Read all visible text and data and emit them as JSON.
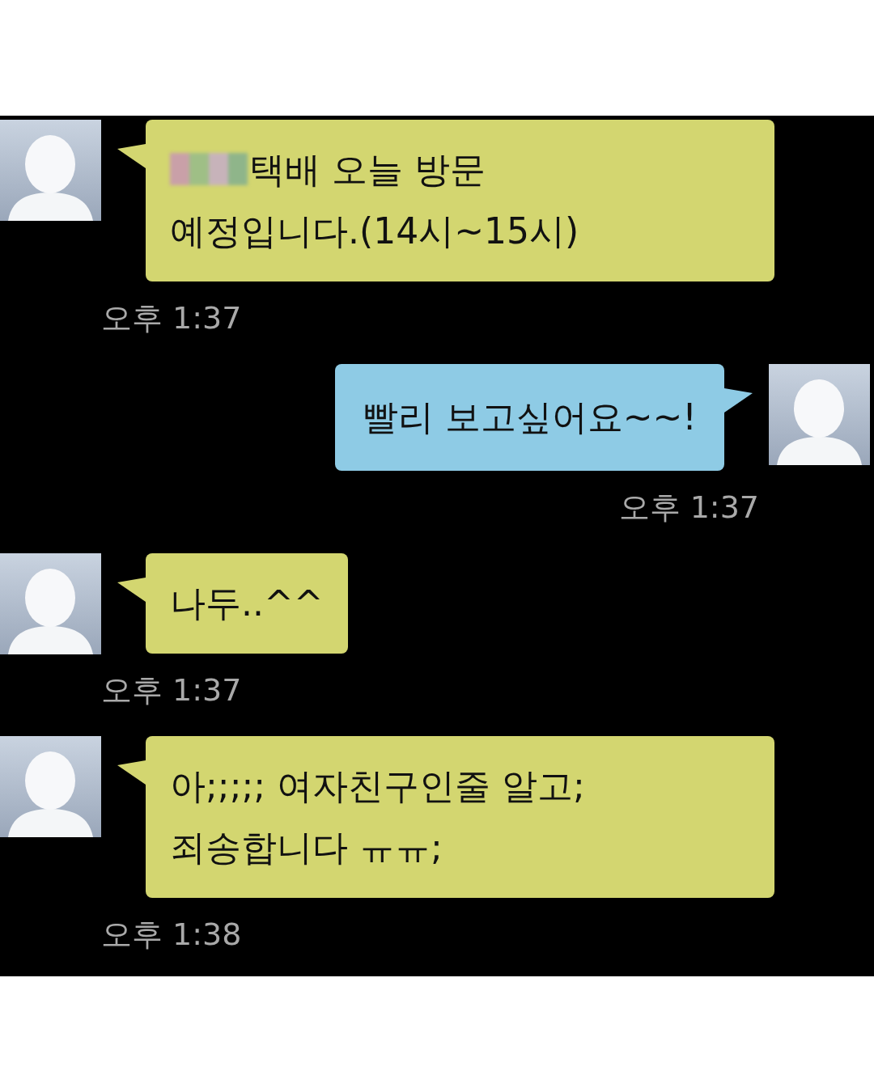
{
  "messages": [
    {
      "kind": "incoming",
      "redacted": true,
      "text": "택배 오늘 방문\n예정입니다.(14시~15시)",
      "time": "오후 1:37"
    },
    {
      "kind": "outgoing",
      "redacted": false,
      "text": "빨리 보고싶어요~~!",
      "time": "오후 1:37"
    },
    {
      "kind": "incoming",
      "redacted": false,
      "text": "나두..^^",
      "time": "오후 1:37"
    },
    {
      "kind": "incoming",
      "redacted": false,
      "text": "아;;;;; 여자친구인줄 알고;\n죄송합니다 ㅠㅠ;",
      "time": "오후 1:38"
    }
  ]
}
